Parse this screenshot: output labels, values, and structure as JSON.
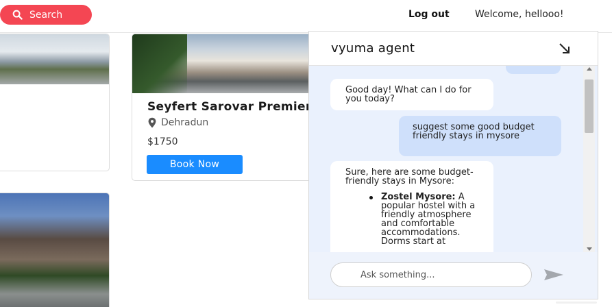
{
  "topbar": {
    "search_label": "Search",
    "logout_label": "Log out",
    "welcome_text": "Welcome, hellooo!",
    "accent_color": "#f44653"
  },
  "hotels": [
    {
      "name": "Seyfert Sarovar Premiere",
      "location": "Dehradun",
      "price": "$1750",
      "book_label": "Book Now"
    }
  ],
  "chat": {
    "title": "vyuma agent",
    "messages": [
      {
        "role": "agent",
        "text": "Good day! What can I do for you today?"
      },
      {
        "role": "user",
        "text": "suggest some good budget friendly stays in mysore"
      },
      {
        "role": "agent",
        "intro": "Sure, here are some budget-friendly stays in Mysore:",
        "list": [
          {
            "title": "Zostel Mysore:",
            "text": "A popular hostel with a friendly atmosphere and comfortable accommodations. Dorms start at"
          }
        ]
      }
    ],
    "input_placeholder": "Ask something...",
    "icons": {
      "minimize": "diagonal-arrow-down-right-icon",
      "send": "send-icon",
      "scroll_down": "arrow-down-icon"
    },
    "colors": {
      "user_bubble": "#cfe0fb",
      "agent_bubble": "#ffffff",
      "messages_bg": "#eaf1fd",
      "book_button": "#1a8cff"
    }
  }
}
